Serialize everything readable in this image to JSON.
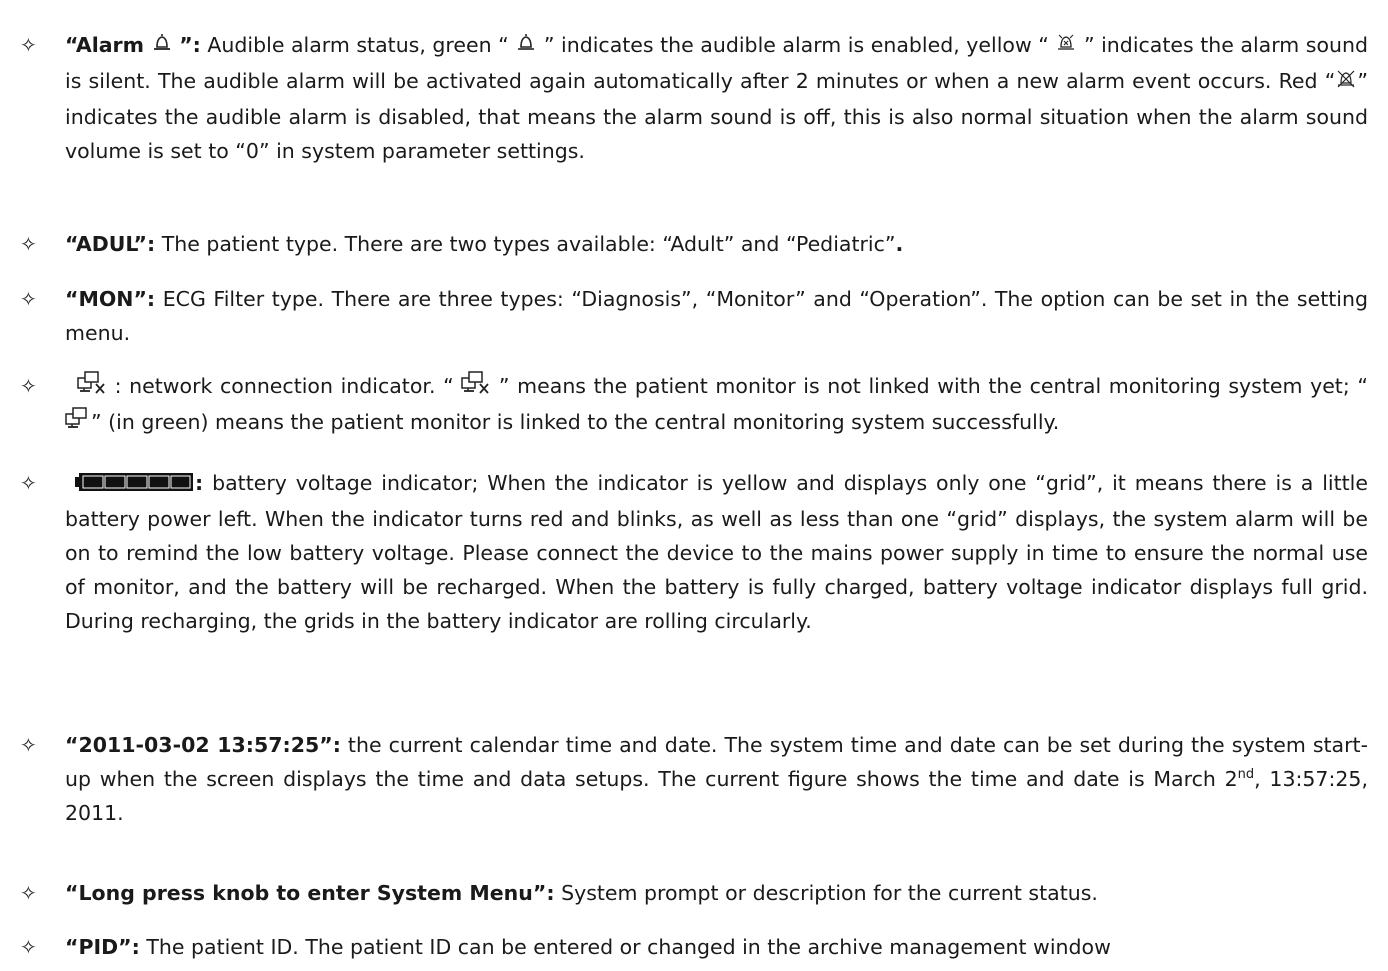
{
  "items": [
    {
      "b1": "“Alarm ",
      "b2": "”:",
      "t1": " Audible alarm status, green “ ",
      "t2": " ” indicates the audible alarm is enabled, yellow “ ",
      "t3": " ” indicates the alarm sound is silent. The audible alarm will be activated again automatically after 2 minutes or when a new alarm event occurs. Red “",
      "t4": "” indicates the audible alarm is disabled, that means the alarm sound is off, this is also normal situation when the alarm sound volume is set to “0” in system parameter settings."
    },
    {
      "b1": "“ADUL”:",
      "t1": " The patient type. There are two types available: “Adult” and “Pediatric”",
      "b2": "."
    },
    {
      "b1": "“MON”:",
      "t1": " ECG Filter type. There are three types: “Diagnosis”, “Monitor” and “Operation”. The option can be set in the setting menu."
    },
    {
      "t1": " : network connection indicator. “ ",
      "t2": " ” means the patient monitor is not linked with the central monitoring system yet; “",
      "t3": "” (in green) means the patient monitor is linked to the central monitoring system successfully."
    },
    {
      "b1": ":",
      "t1": " battery voltage indicator; When the indicator is yellow and displays only one “grid”, it means there is a little battery power left. When the indicator turns red and blinks, as well as less than one “grid” displays, the system alarm will be on to remind the low battery voltage. Please connect the device to the mains power supply in time to ensure the normal use of monitor, and the battery will be recharged. When the battery is fully charged, battery voltage indicator displays full grid. During recharging, the grids in the battery indicator are rolling circularly."
    },
    {
      "b1": "“2011-03-02 13:57:25”:",
      "t1": " the current calendar time and date. The system time and date can be set during the system start-up when the screen displays the time and data setups. The current figure shows the time and date is March 2",
      "sup": "nd",
      "t2": ", 13:57:25, 2011."
    },
    {
      "b1": "“Long press knob to enter System Menu”:",
      "t1": " System prompt or description for the current status."
    },
    {
      "b1": "“PID”:",
      "t1": " The patient ID. The patient ID can be entered or changed in the archive management window"
    }
  ],
  "bullet": "✧",
  "icons": [
    "bell-icon",
    "bell-muted-icon",
    "bell-off-icon",
    "network-disconnected-icon",
    "network-connected-icon",
    "battery-full-icon"
  ]
}
